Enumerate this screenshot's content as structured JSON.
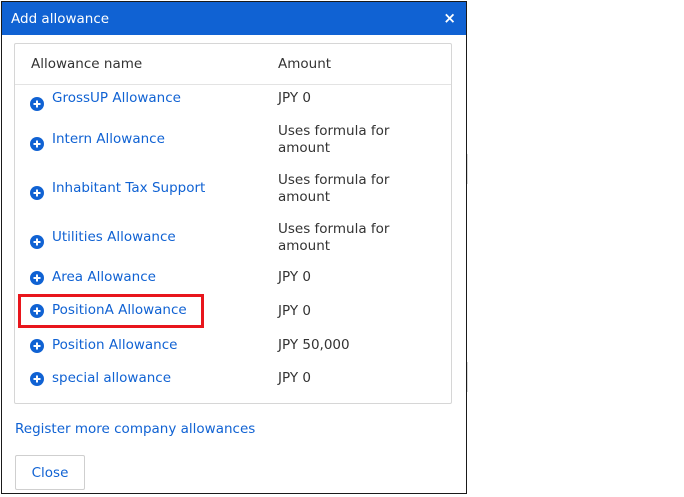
{
  "dialog": {
    "title": "Add allowance",
    "close_glyph": "×"
  },
  "table": {
    "columns": {
      "name": "Allowance name",
      "amount": "Amount"
    },
    "rows": [
      {
        "name": "GrossUP Allowance",
        "amount": "JPY 0",
        "icon": "plus-circle-icon"
      },
      {
        "name": "Intern Allowance",
        "amount": "Uses formula for amount",
        "icon": "plus-circle-icon"
      },
      {
        "name": "Inhabitant Tax Support",
        "amount": "Uses formula for amount",
        "icon": "plus-circle-icon"
      },
      {
        "name": "Utilities Allowance",
        "amount": "Uses formula for amount",
        "icon": "plus-circle-icon"
      },
      {
        "name": "Area Allowance",
        "amount": "JPY 0",
        "icon": "plus-circle-icon"
      },
      {
        "name": "PositionA Allowance",
        "amount": "JPY 0",
        "icon": "plus-circle-icon",
        "highlighted": true
      },
      {
        "name": "Position Allowance",
        "amount": "JPY 50,000",
        "icon": "plus-circle-icon"
      },
      {
        "name": "special allowance",
        "amount": "JPY 0",
        "icon": "plus-circle-icon"
      }
    ]
  },
  "footer": {
    "register_link": "Register more company allowances",
    "close_label": "Close"
  },
  "colors": {
    "header_bg": "#1062d3",
    "link": "#1062d3",
    "highlight": "#e8161c"
  }
}
